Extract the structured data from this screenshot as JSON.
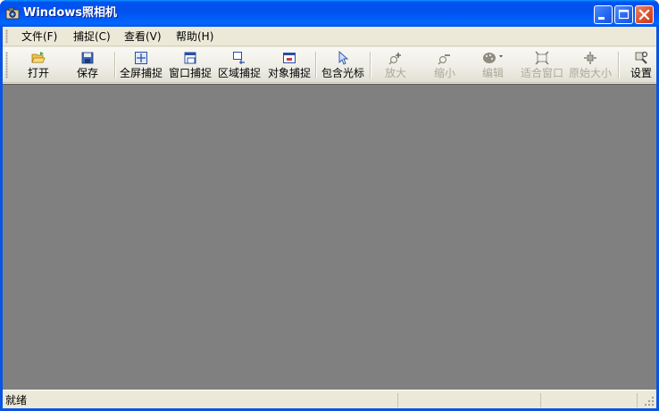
{
  "window": {
    "title": "Windows照相机"
  },
  "menu": {
    "items": [
      {
        "label": "文件(F)",
        "name": "menu-file"
      },
      {
        "label": "捕捉(C)",
        "name": "menu-capture"
      },
      {
        "label": "查看(V)",
        "name": "menu-view"
      },
      {
        "label": "帮助(H)",
        "name": "menu-help"
      }
    ]
  },
  "toolbar": {
    "open": "打开",
    "save": "保存",
    "fullscreen": "全屏捕捉",
    "window": "窗口捕捉",
    "region": "区域捕捉",
    "object": "对象捕捉",
    "cursor": "包含光标",
    "zoom_in": "放大",
    "zoom_out": "缩小",
    "edit": "编辑",
    "fit": "适合窗口",
    "actual": "原始大小",
    "settings": "设置"
  },
  "status": {
    "text": "就绪"
  },
  "colors": {
    "title_bar": "#0054e3",
    "canvas": "#808080",
    "chrome": "#ece9d8"
  }
}
